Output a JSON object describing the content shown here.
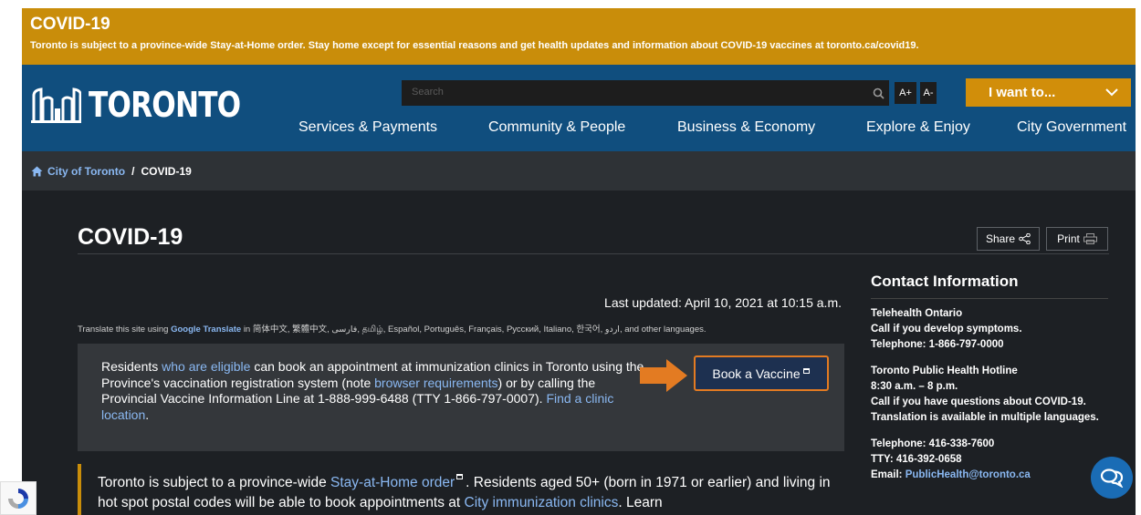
{
  "alert": {
    "title": "COVID-19",
    "message": "Toronto is subject to a province-wide Stay-at-Home order. Stay home except for essential reasons and get health updates and information about COVID-19 vaccines at toronto.ca/covid19."
  },
  "header": {
    "logo_text": "TORONTO",
    "search_placeholder": "Search",
    "font_increase": "A+",
    "font_decrease": "A-",
    "i_want_to": "I want to...",
    "nav": [
      "Services & Payments",
      "Community & People",
      "Business & Economy",
      "Explore & Enjoy",
      "City Government"
    ]
  },
  "breadcrumb": {
    "home": "City of Toronto",
    "separator": "/",
    "current": "COVID-19"
  },
  "page": {
    "title": "COVID-19",
    "share": "Share",
    "print": "Print",
    "last_updated": "Last updated: April 10, 2021 at 10:15 a.m.",
    "translate": {
      "prefix": "Translate this site using",
      "link": "Google Translate",
      "languages": "in 简体中文, 繁體中文, فارسی, தமிழ், Español, Português, Français, Русский, Italiano, 한국어, اردو, and other languages."
    }
  },
  "callout": {
    "t1": "Residents",
    "link1": "who are eligible",
    "t2": "can book an appointment at immunization clinics in Toronto using the Province's vaccination registration system (note",
    "link2": "browser requirements",
    "t3": ") or by calling the Provincial Vaccine Information Line at 1-888-999-6488 (TTY 1-866-797-0007).",
    "link3": "Find a clinic location",
    "t4": ".",
    "button": "Book a Vaccine"
  },
  "notice": {
    "t1": "Toronto is subject to a province-wide",
    "link1": "Stay-at-Home order",
    "t2": ". Residents aged 50+ (born in 1971 or earlier) and living in hot spot postal codes will be able to book appointments at",
    "link2": "City immunization clinics",
    "t3": ". Learn"
  },
  "contact": {
    "title": "Contact Information",
    "telehealth": {
      "name": "Telehealth Ontario",
      "desc": "Call if you develop symptoms.",
      "phone": "Telephone: 1-866-797-0000"
    },
    "hotline": {
      "name": "Toronto Public Health Hotline",
      "hours": "8:30 a.m. – 8 p.m.",
      "desc": "Call if you have questions about COVID-19. Translation is available in multiple languages."
    },
    "phones": {
      "tel": "Telephone: 416-338-7600",
      "tty": "TTY: 416-392-0658",
      "email_label": "Email:",
      "email": "PublicHealth@toronto.ca"
    }
  },
  "colors": {
    "alert": "#c98d0a",
    "header": "#104e7e",
    "accent": "#d18e0a",
    "link": "#8ab8f2",
    "dark_bg": "#1d2024"
  }
}
